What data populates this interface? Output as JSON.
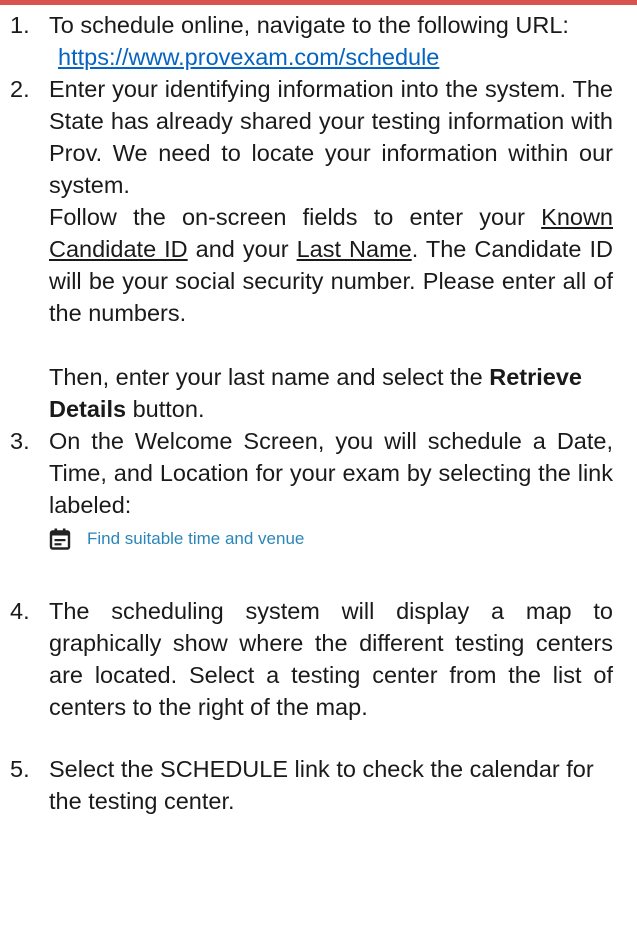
{
  "colors": {
    "top_rule": "#d9534f",
    "link_blue": "#0563c1",
    "widget_blue": "#2a86b8",
    "text": "#1a1a1a"
  },
  "steps": [
    {
      "number": "1.",
      "text_1": "To schedule online, navigate to the following URL:",
      "url": "https://www.provexam.com/schedule"
    },
    {
      "number": "2.",
      "text_1": "Enter your identifying information into the system.  The State has already shared your testing information with Prov.  We need to locate your information within our system.",
      "text_2a": "Follow the on-screen fields to enter your ",
      "known_id": "Known Candidate ID",
      "and_your": " and your ",
      "last_name": "Last Name",
      "text_2b": ".  The Candidate ID will be your social security number.  Please enter all of the numbers.",
      "text_3a": "Then, enter your last name and select the ",
      "button_name": "Retrieve Details",
      "text_3b": " button."
    },
    {
      "number": "3.",
      "text_1": "On the Welcome Screen, you will schedule a Date, Time, and Location for your exam by selecting the link labeled:",
      "link_icon": "calendar-list-icon",
      "link_label": "Find suitable time and venue"
    },
    {
      "number": "4.",
      "text_1": "The scheduling system will display a map to graphically show where the different testing centers are located.  Select a testing center from the list of centers to the right of the map."
    },
    {
      "number": "5.",
      "text_1": "Select the SCHEDULE link to check the calendar for the testing center."
    }
  ]
}
